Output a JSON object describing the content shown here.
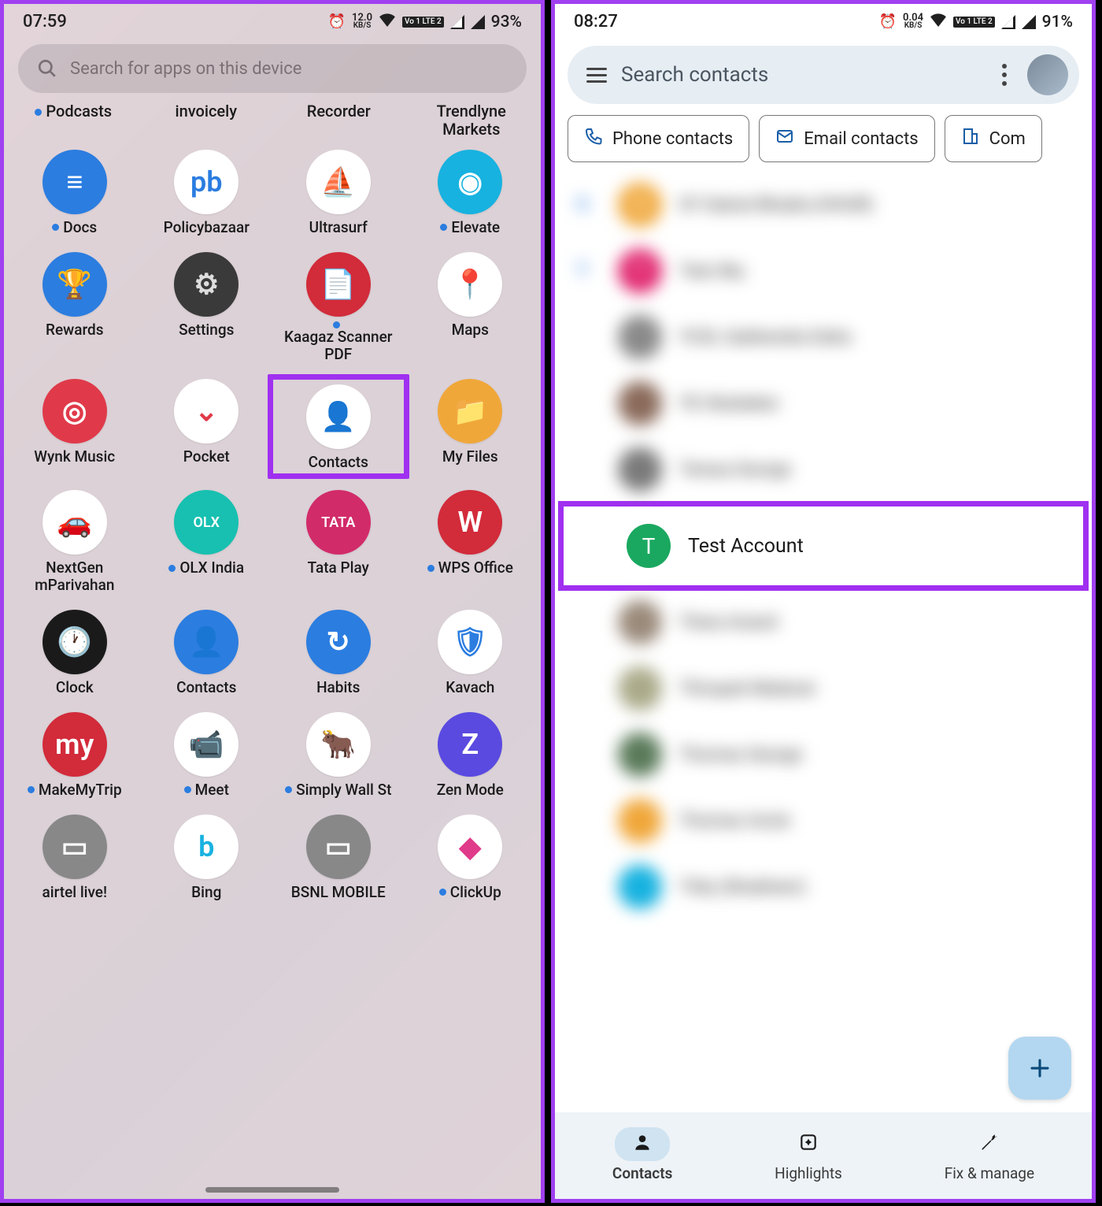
{
  "left": {
    "status": {
      "time": "07:59",
      "net_val": "12.0",
      "net_unit": "KB/S",
      "lte": "Vo 1 LTE 2",
      "battery": "93%"
    },
    "search_placeholder": "Search for apps on this device",
    "text_row": [
      {
        "label": "Podcasts",
        "dot": true
      },
      {
        "label": "invoicely",
        "dot": false
      },
      {
        "label": "Recorder",
        "dot": false
      },
      {
        "label": "Trendlyne Markets",
        "dot": false
      }
    ],
    "apps": [
      {
        "label": "Docs",
        "dot": true,
        "bg": "#2b7de0",
        "glyph": "≡",
        "glyph_color": "#fff"
      },
      {
        "label": "Policybazaar",
        "dot": false,
        "bg": "#ffffff",
        "glyph": "pb",
        "glyph_color": "#2b7de0"
      },
      {
        "label": "Ultrasurf",
        "dot": false,
        "bg": "#ffffff",
        "glyph": "⛵",
        "glyph_color": "#e08a2b"
      },
      {
        "label": "Elevate",
        "dot": true,
        "bg": "#17b2e0",
        "glyph": "◉",
        "glyph_color": "#fff"
      },
      {
        "label": "Rewards",
        "dot": false,
        "bg": "#2b7de0",
        "glyph": "🏆",
        "glyph_color": "#fff"
      },
      {
        "label": "Settings",
        "dot": false,
        "bg": "#3a3a3a",
        "glyph": "⚙",
        "glyph_color": "#ddd"
      },
      {
        "label": "Kaagaz Scanner PDF",
        "dot": true,
        "bg": "#d22b3a",
        "glyph": "📄",
        "glyph_color": "#fff"
      },
      {
        "label": "Maps",
        "dot": false,
        "bg": "#ffffff",
        "glyph": "📍",
        "glyph_color": "#d22b3a"
      },
      {
        "label": "Wynk Music",
        "dot": false,
        "bg": "#e03a4a",
        "glyph": "◎",
        "glyph_color": "#fff"
      },
      {
        "label": "Pocket",
        "dot": false,
        "bg": "#ffffff",
        "glyph": "⌄",
        "glyph_color": "#e03a4a"
      },
      {
        "label": "Contacts",
        "dot": false,
        "bg": "#ffffff",
        "glyph": "👤",
        "glyph_color": "#2b7de0",
        "highlight": true
      },
      {
        "label": "My Files",
        "dot": false,
        "bg": "#f0a73a",
        "glyph": "📁",
        "glyph_color": "#fff"
      },
      {
        "label": "NextGen mParivahan",
        "dot": false,
        "bg": "#ffffff",
        "glyph": "🚗",
        "glyph_color": "#d22b3a"
      },
      {
        "label": "OLX India",
        "dot": true,
        "bg": "#17c0b0",
        "glyph": "OLX",
        "glyph_color": "#fff"
      },
      {
        "label": "Tata Play",
        "dot": false,
        "bg": "#d22b6a",
        "glyph": "TATA",
        "glyph_color": "#fff"
      },
      {
        "label": "WPS Office",
        "dot": true,
        "bg": "#d22b3a",
        "glyph": "W",
        "glyph_color": "#fff"
      },
      {
        "label": "Clock",
        "dot": false,
        "bg": "#1a1a1a",
        "glyph": "🕐",
        "glyph_color": "#fff"
      },
      {
        "label": "Contacts",
        "dot": false,
        "bg": "#2b7de0",
        "glyph": "👤",
        "glyph_color": "#fff"
      },
      {
        "label": "Habits",
        "dot": false,
        "bg": "#2b7de0",
        "glyph": "↻",
        "glyph_color": "#fff"
      },
      {
        "label": "Kavach",
        "dot": false,
        "bg": "#ffffff",
        "glyph": "🛡",
        "glyph_color": "#2b7de0"
      },
      {
        "label": "MakeMyTrip",
        "dot": true,
        "bg": "#d22b3a",
        "glyph": "my",
        "glyph_color": "#fff"
      },
      {
        "label": "Meet",
        "dot": true,
        "bg": "#ffffff",
        "glyph": "📹",
        "glyph_color": "#1aa860"
      },
      {
        "label": "Simply Wall St",
        "dot": true,
        "bg": "#ffffff",
        "glyph": "🐂",
        "glyph_color": "#8a5a2a"
      },
      {
        "label": "Zen Mode",
        "dot": false,
        "bg": "#5a4ae0",
        "glyph": "Z",
        "glyph_color": "#fff"
      },
      {
        "label": "airtel live!",
        "dot": false,
        "bg": "#888",
        "glyph": "▭",
        "glyph_color": "#fff"
      },
      {
        "label": "Bing",
        "dot": false,
        "bg": "#ffffff",
        "glyph": "b",
        "glyph_color": "#17b2e0"
      },
      {
        "label": "BSNL MOBILE",
        "dot": false,
        "bg": "#888",
        "glyph": "▭",
        "glyph_color": "#fff"
      },
      {
        "label": "ClickUp",
        "dot": true,
        "bg": "#ffffff",
        "glyph": "◆",
        "glyph_color": "#e03a8a"
      }
    ]
  },
  "right": {
    "status": {
      "time": "08:27",
      "net_val": "0.04",
      "net_unit": "KB/S",
      "lte": "Vo 1 LTE 2",
      "battery": "91%"
    },
    "search_placeholder": "Search contacts",
    "chips": [
      {
        "icon": "phone",
        "label": "Phone contacts",
        "color": "#1a5ea8"
      },
      {
        "icon": "mail",
        "label": "Email contacts",
        "color": "#1a5ea8"
      },
      {
        "icon": "building",
        "label": "Com",
        "color": "#1a5ea8"
      }
    ],
    "blurred_before": [
      {
        "letter": "S",
        "avatar_bg": "#f0a73a",
        "initial": "S",
        "name": "SY Sukrat Bhukla (HHUR)"
      },
      {
        "letter": "T",
        "avatar_bg": "#e0206a",
        "initial": "T",
        "name": "Tata Sky"
      },
      {
        "letter": "",
        "avatar_bg": "#8a8a8a",
        "initial": "",
        "name": "YCSL Subhendra Daha"
      },
      {
        "letter": "",
        "avatar_bg": "#8a6a5a",
        "initial": "",
        "name": "YD Abubakar"
      },
      {
        "letter": "",
        "avatar_bg": "#7a7a7a",
        "initial": "",
        "name": "Teresa George"
      }
    ],
    "focus_contact": {
      "initial": "T",
      "name": "Test Account"
    },
    "blurred_after": [
      {
        "avatar_bg": "#9a8a7a",
        "name": "Thera Anand"
      },
      {
        "avatar_bg": "#aaaa8a",
        "name": "Thirupati Madurai"
      },
      {
        "avatar_bg": "#5a7a5a",
        "name": "Thomas George"
      },
      {
        "avatar_bg": "#f0a73a",
        "name": "Thomas Uncle"
      },
      {
        "avatar_bg": "#17b2e0",
        "name": "Triky (Shubham)"
      }
    ],
    "tabs": [
      {
        "label": "Contacts",
        "icon": "person",
        "active": true
      },
      {
        "label": "Highlights",
        "icon": "sparkle",
        "active": false
      },
      {
        "label": "Fix & manage",
        "icon": "wrench",
        "active": false
      }
    ]
  }
}
